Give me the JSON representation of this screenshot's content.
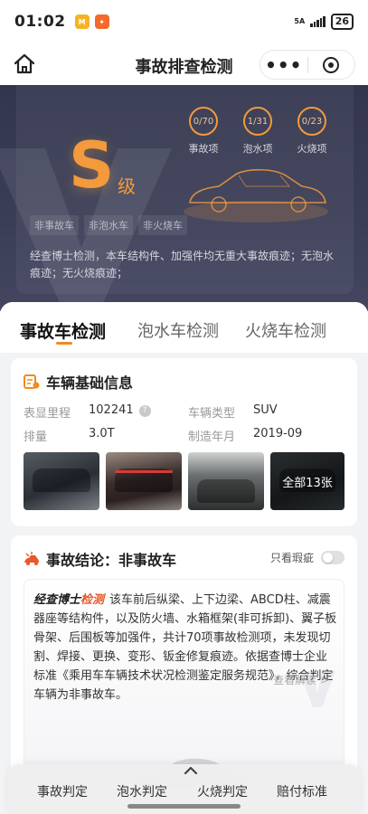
{
  "status_bar": {
    "time": "01:02",
    "net": "5A",
    "battery": "26"
  },
  "nav": {
    "title": "事故排查检测",
    "more_label": "•••"
  },
  "hero": {
    "grade_letter": "S",
    "grade_suffix": "级",
    "stats": [
      {
        "value": "0/70",
        "label": "事故项"
      },
      {
        "value": "1/31",
        "label": "泡水项"
      },
      {
        "value": "0/23",
        "label": "火烧项"
      }
    ],
    "tags": [
      "非事故车",
      "非泡水车",
      "非火烧车"
    ],
    "description": "经查博士检测，本车结构件、加强件均无重大事故痕迹；无泡水痕迹；无火烧痕迹；",
    "accent_color": "#f29a3c"
  },
  "tabs": [
    {
      "label": "事故车检测",
      "active": true
    },
    {
      "label": "泡水车检测",
      "active": false
    },
    {
      "label": "火烧车检测",
      "active": false
    }
  ],
  "vehicle_info": {
    "title": "车辆基础信息",
    "mileage_label": "表显里程",
    "mileage_value": "102241",
    "type_label": "车辆类型",
    "type_value": "SUV",
    "displacement_label": "排量",
    "displacement_value": "3.0T",
    "year_label": "制造年月",
    "year_value": "2019-09",
    "all_photos_label": "全部13张"
  },
  "conclusion": {
    "title": "事故结论：非事故车",
    "toggle_label": "只看瑕疵",
    "toggle_on": false,
    "brand_prefix": "经查博士",
    "brand_suffix": "检测",
    "text": "该车前后纵梁、上下边梁、ABCD柱、减震器座等结构件，以及防火墙、水箱框架(非可拆卸)、翼子板骨架、后围板等加强件，共计70项事故检测项，未发现切割、焊接、更换、变形、钣金修复痕迹。依据查博士企业标准《乘用车车辆技术状况检测鉴定服务规范》，综合判定车辆为非事故车。",
    "view_more": "查看解读 >"
  },
  "bottom_nav": [
    "事故判定",
    "泡水判定",
    "火烧判定",
    "赔付标准"
  ]
}
